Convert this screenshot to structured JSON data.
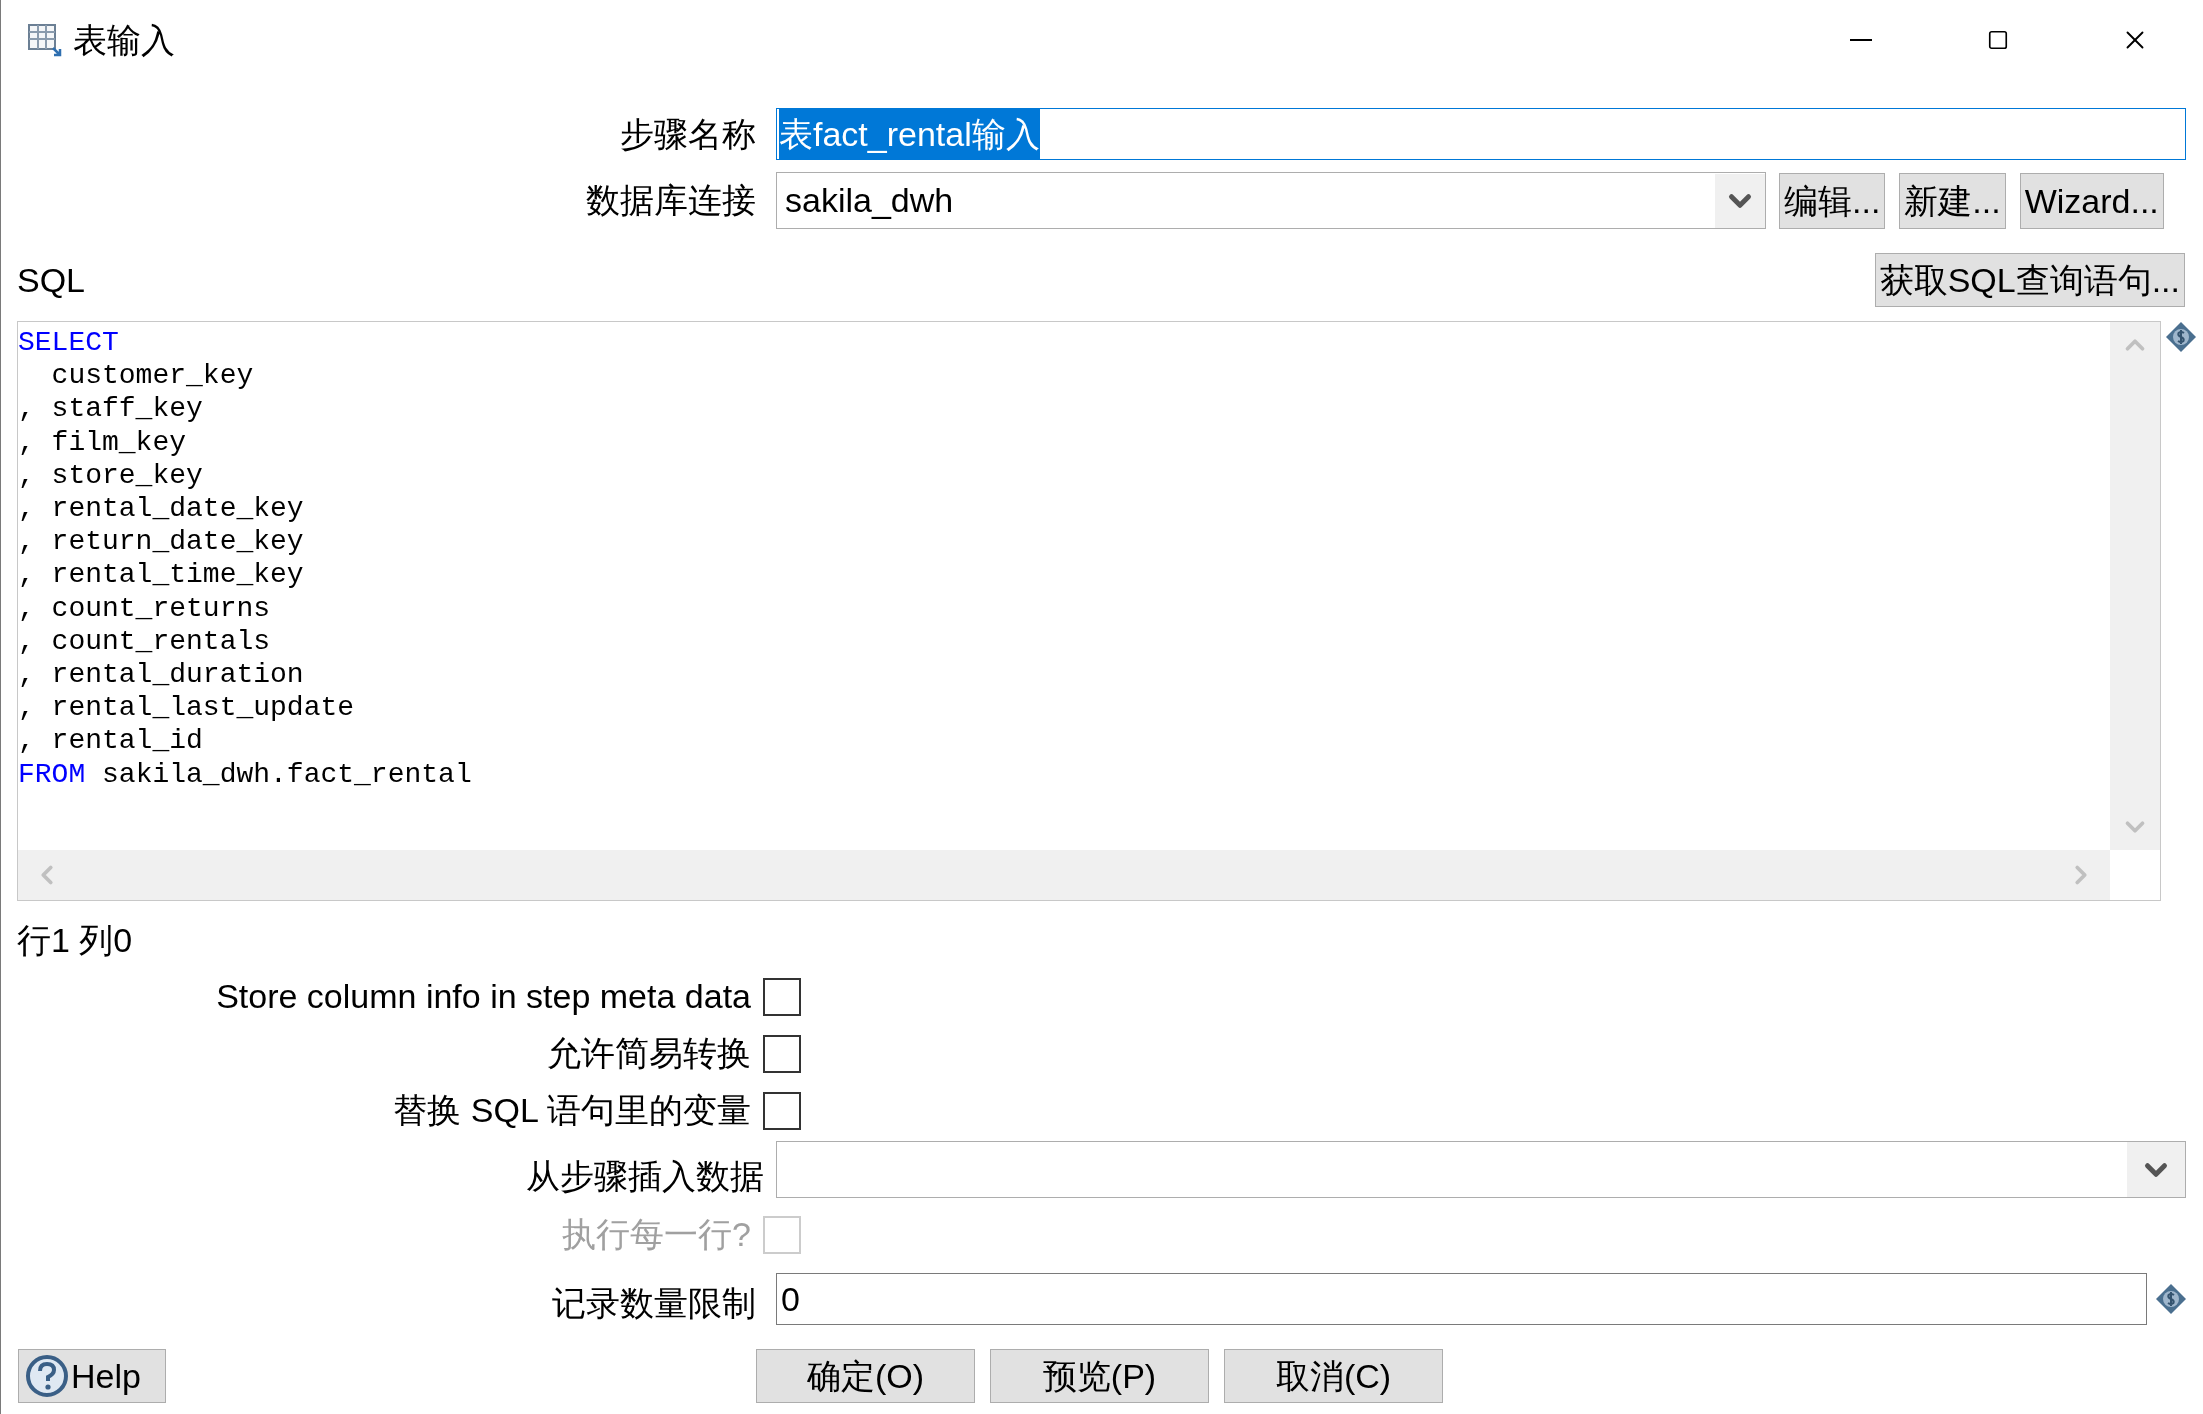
{
  "window": {
    "title": "表输入"
  },
  "step_name": {
    "label": "步骤名称",
    "value": "表fact_rental输入",
    "text_selected": true
  },
  "connection": {
    "label": "数据库连接",
    "value": "sakila_dwh",
    "buttons": [
      "编辑...",
      "新建...",
      "Wizard..."
    ]
  },
  "sql": {
    "label": "SQL",
    "button": "获取SQL查询语句...",
    "lines": [
      [
        {
          "kind": "keyword",
          "text": "SELECT"
        }
      ],
      [
        {
          "kind": "plain",
          "text": "  customer_key"
        }
      ],
      [
        {
          "kind": "plain",
          "text": ", staff_key"
        }
      ],
      [
        {
          "kind": "plain",
          "text": ", film_key"
        }
      ],
      [
        {
          "kind": "plain",
          "text": ", store_key"
        }
      ],
      [
        {
          "kind": "plain",
          "text": ", rental_date_key"
        }
      ],
      [
        {
          "kind": "plain",
          "text": ", return_date_key"
        }
      ],
      [
        {
          "kind": "plain",
          "text": ", rental_time_key"
        }
      ],
      [
        {
          "kind": "plain",
          "text": ", count_returns"
        }
      ],
      [
        {
          "kind": "plain",
          "text": ", count_rentals"
        }
      ],
      [
        {
          "kind": "plain",
          "text": ", rental_duration"
        }
      ],
      [
        {
          "kind": "plain",
          "text": ", rental_last_update"
        }
      ],
      [
        {
          "kind": "plain",
          "text": ", rental_id"
        }
      ],
      [
        {
          "kind": "keyword",
          "text": "FROM"
        },
        {
          "kind": "plain",
          "text": " sakila_dwh.fact_rental"
        }
      ]
    ],
    "cursor_position": "行1 列0"
  },
  "options": [
    {
      "kind": "checkbox",
      "label": "Store column info in step meta data",
      "checked": false,
      "disabled": false
    },
    {
      "kind": "checkbox",
      "label": "允许简易转换",
      "checked": false,
      "disabled": false
    },
    {
      "kind": "checkbox",
      "label": "替换 SQL 语句里的变量",
      "checked": false,
      "disabled": false
    },
    {
      "kind": "dropdown",
      "label": "从步骤插入数据"
    },
    {
      "kind": "checkbox",
      "label": "执行每一行?",
      "checked": false,
      "disabled": true
    },
    {
      "kind": "text",
      "label": "记录数量限制",
      "value": "0"
    }
  ],
  "help_button": "Help",
  "buttons": [
    "确定(O)",
    "预览(P)",
    "取消(C)"
  ]
}
